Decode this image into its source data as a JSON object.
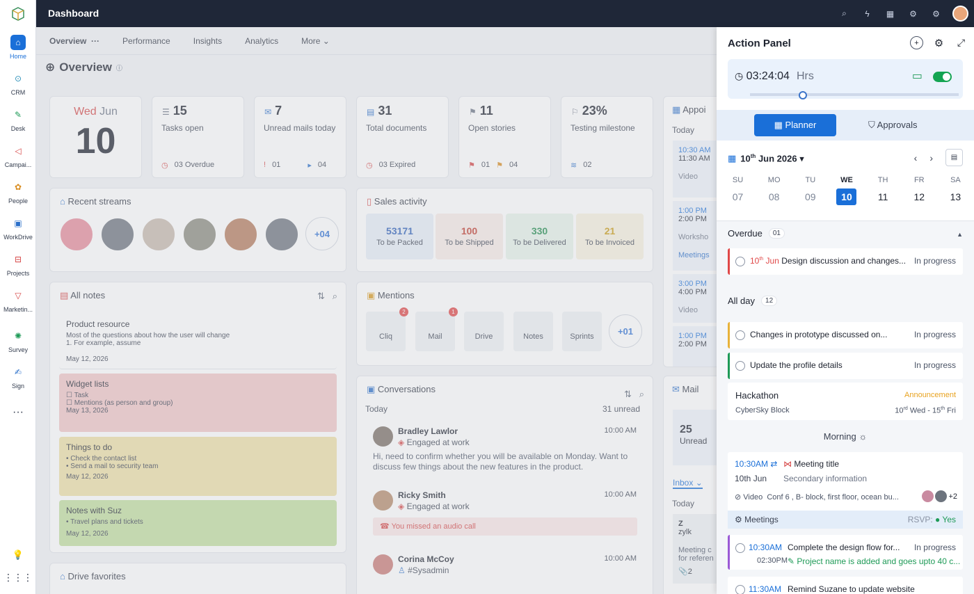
{
  "rail": [
    {
      "label": "Home",
      "icon": "home-icon",
      "active": true
    },
    {
      "label": "CRM",
      "icon": "crm-icon"
    },
    {
      "label": "Desk",
      "icon": "desk-icon"
    },
    {
      "label": "Campai...",
      "icon": "campaign-icon"
    },
    {
      "label": "People",
      "icon": "people-icon"
    },
    {
      "label": "WorkDrive",
      "icon": "workdrive-icon"
    },
    {
      "label": "Projects",
      "icon": "projects-icon"
    },
    {
      "label": "Marketin...",
      "icon": "marketing-icon"
    },
    {
      "label": "Survey",
      "icon": "survey-icon"
    },
    {
      "label": "Sign",
      "icon": "sign-icon"
    }
  ],
  "topbar": {
    "title": "Dashboard"
  },
  "subnav": {
    "overview": "Overview",
    "performance": "Performance",
    "insights": "Insights",
    "analytics": "Analytics",
    "more": "More"
  },
  "overview_title": "Overview",
  "date": {
    "weekday": "Wed",
    "month": "Jun",
    "day": "10"
  },
  "stats": [
    {
      "num": "15",
      "label": "Tasks open",
      "sub1": "03 Overdue",
      "sub2": ""
    },
    {
      "num": "7",
      "label": "Unread mails today",
      "sub1": "01",
      "sub2": "04"
    },
    {
      "num": "31",
      "label": "Total documents",
      "sub1": "03 Expired",
      "sub2": ""
    },
    {
      "num": "11",
      "label": "Open stories",
      "sub1": "01",
      "sub2": "04"
    },
    {
      "num": "23%",
      "label": "Testing milestone",
      "sub1": "02",
      "sub2": ""
    }
  ],
  "appointments": {
    "title": "Appoi",
    "today": "Today",
    "items": [
      {
        "t1": "10:30 AM",
        "t2": "11:30 AM",
        "d": "Video"
      },
      {
        "t1": "1:00 PM",
        "t2": "2:00 PM",
        "d": "Worksho"
      },
      {
        "t1": "3:00 PM",
        "t2": "4:00 PM",
        "d": "Video"
      },
      {
        "t1": "1:00 PM",
        "t2": "2:00 PM",
        "d": ""
      }
    ],
    "meetings": "Meetings"
  },
  "streams": {
    "title": "Recent streams",
    "more": "+04"
  },
  "sales": {
    "title": "Sales activity",
    "boxes": [
      {
        "v": "53171",
        "l": "To be Packed",
        "c": "#2b5fb8"
      },
      {
        "v": "100",
        "l": "To be Shipped",
        "c": "#c0392b"
      },
      {
        "v": "330",
        "l": "To be Delivered",
        "c": "#1e8a4c"
      },
      {
        "v": "21",
        "l": "To be Invoiced",
        "c": "#c99a12"
      }
    ]
  },
  "notes": {
    "title": "All notes",
    "items": [
      {
        "title": "Product resource",
        "body": "Most of the questions about how the user will change",
        "body2": "1. For example, assume",
        "date": "May 12, 2026"
      },
      {
        "title": "Widget lists",
        "body": "Task",
        "body2": "Mentions (as person and group)",
        "date": "May 13, 2026"
      },
      {
        "title": "Things to do",
        "body": "Check the contact list",
        "body2": "Send a mail to security team",
        "date": "May 12, 2026"
      },
      {
        "title": "Notes with Suz",
        "body": "Travel plans and tickets",
        "body2": "",
        "date": "May 12, 2026"
      }
    ]
  },
  "mentions": {
    "title": "Mentions",
    "tiles": [
      {
        "l": "Cliq",
        "b": "2"
      },
      {
        "l": "Mail",
        "b": "1"
      },
      {
        "l": "Drive",
        "b": ""
      },
      {
        "l": "Notes",
        "b": ""
      },
      {
        "l": "Sprints",
        "b": ""
      }
    ],
    "more": "+01"
  },
  "conversations": {
    "title": "Conversations",
    "today": "Today",
    "unread": "31 unread",
    "items": [
      {
        "name": "Bradley Lawlor",
        "status": "Engaged at work",
        "time": "10:00 AM",
        "msg": "Hi, need to confirm whether you will be available on Monday. Want to discuss few things about the new features in the product."
      },
      {
        "name": "Ricky Smith",
        "status": "Engaged at work",
        "time": "10:00 AM",
        "msg": "You missed an audio call"
      },
      {
        "name": "Corina McCoy",
        "status": "#Sysadmin",
        "time": "10:00 AM",
        "msg": ""
      }
    ]
  },
  "mail": {
    "title": "Mail",
    "count": "25",
    "unread": "Unread",
    "inbox": "Inbox",
    "u": "U",
    "today": "Today",
    "preview": "Meeting c",
    "preview2": "for referen",
    "sender": "Z",
    "sender2": "zylk",
    "att": "2"
  },
  "drive": {
    "title": "Drive favorites"
  },
  "panel": {
    "title": "Action Panel",
    "timer": "03:24:04",
    "hrs": "Hrs",
    "planner": "Planner",
    "approvals": "Approvals",
    "date": "10",
    "date_sup": "th",
    "date_rest": "Jun 2026",
    "week": [
      {
        "d": "SU",
        "n": "07"
      },
      {
        "d": "MO",
        "n": "08"
      },
      {
        "d": "TU",
        "n": "09"
      },
      {
        "d": "WE",
        "n": "10"
      },
      {
        "d": "TH",
        "n": "11"
      },
      {
        "d": "FR",
        "n": "12"
      },
      {
        "d": "SA",
        "n": "13"
      }
    ],
    "overdue": "Overdue",
    "overdue_count": "01",
    "overdue_task": {
      "date": "10",
      "date_sup": "th",
      "date_mon": "Jun",
      "text": "Design discussion and changes...",
      "status": "In progress"
    },
    "allday": "All day",
    "allday_count": "12",
    "allday_tasks": [
      {
        "text": "Changes in prototype discussed on...",
        "status": "In progress"
      },
      {
        "text": "Update the profile details",
        "status": "In progress"
      }
    ],
    "hackathon": {
      "title": "Hackathon",
      "tag": "Announcement",
      "place": "CyberSky Block",
      "range": "10",
      "range_sup1": "rd",
      "range_mid": "Wed - 15",
      "range_sup2": "th",
      "range_end": "Fri"
    },
    "morning": "Morning",
    "meeting": {
      "time": "10:30AM",
      "date": "10th Jun",
      "title": "Meeting title",
      "info": "Secondary information",
      "type": "Video",
      "loc": "Conf 6 , B- block, first floor, ocean bu...",
      "extra": "+2",
      "cat": "Meetings",
      "rsvp": "RSVP:",
      "yes": "Yes"
    },
    "tasks2": [
      {
        "time": "10:30AM",
        "time2": "02:30PM",
        "text": "Complete the design flow for...",
        "sub": "Project name is added and goes upto 40 c...",
        "status": "In progress"
      },
      {
        "time": "11:30AM",
        "text": "Remind Suzane to update website"
      }
    ]
  }
}
